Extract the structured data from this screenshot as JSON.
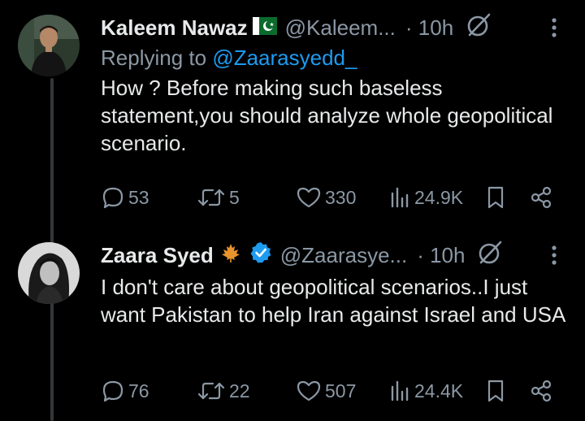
{
  "tweets": [
    {
      "name": "Kaleem Nawaz",
      "handle": "@Kaleem...",
      "time": "· 10h",
      "replying_prefix": "Replying to ",
      "replying_to": "@Zaarasyedd_",
      "text": "How ? Before making such baseless statement,you should analyze whole geopolitical scenario.",
      "stats": {
        "replies": "53",
        "retweets": "5",
        "likes": "330",
        "views": "24.9K"
      }
    },
    {
      "name": "Zaara Syed",
      "handle": "@Zaarasye...",
      "time": "· 10h",
      "text": "I don't care about geopolitical scenarios..I just want Pakistan to help Iran against Israel and USA",
      "stats": {
        "replies": "76",
        "retweets": "22",
        "likes": "507",
        "views": "24.4K"
      }
    }
  ],
  "colors": {
    "background": "#000000",
    "text": "#e7e9ea",
    "muted": "#8b98a5",
    "link": "#1d9bf0",
    "verified": "#1d9bf0",
    "maple": "#e8942e"
  }
}
